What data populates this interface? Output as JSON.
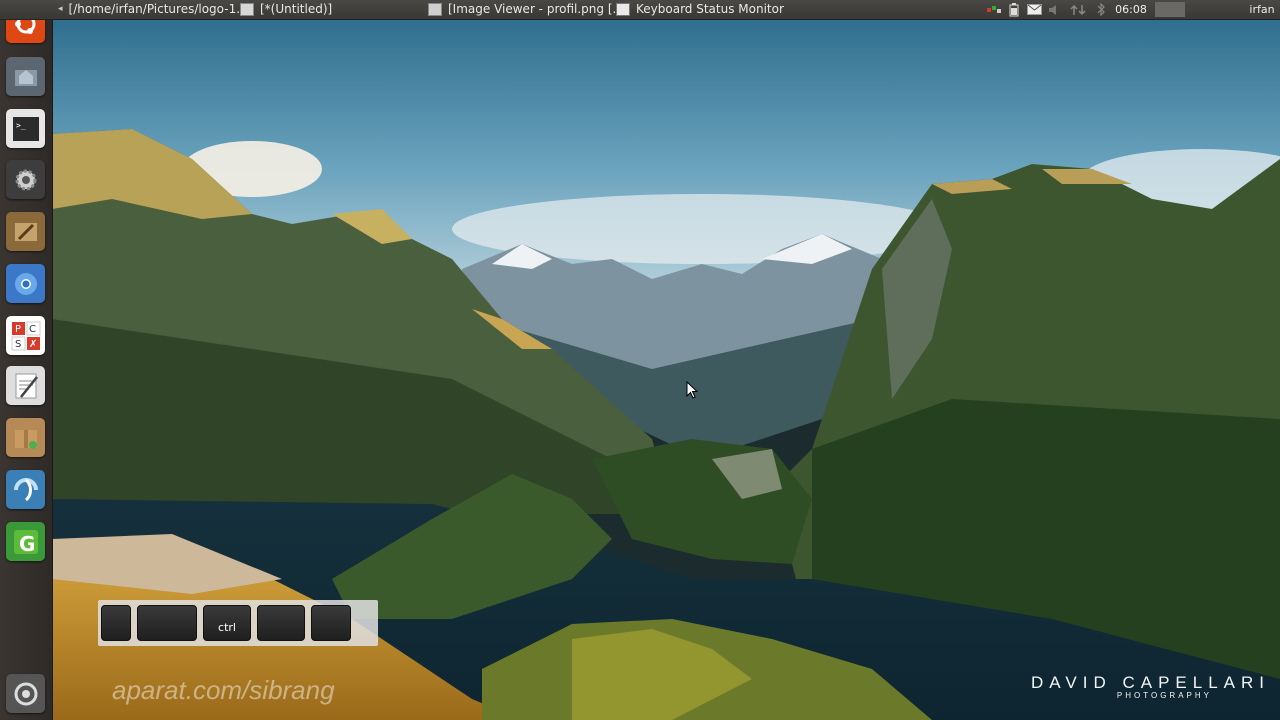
{
  "top_panel": {
    "tasks": [
      {
        "label": "[/home/irfan/Pictures/logo-1...",
        "icon": "terminal-icon"
      },
      {
        "label": "[*(Untitled)]",
        "icon": "text-editor-icon"
      },
      {
        "label": "[Image Viewer - profil.png [...",
        "icon": "image-viewer-icon"
      },
      {
        "label": "Keyboard Status Monitor",
        "icon": "keyboard-monitor-icon"
      }
    ],
    "tray_icons": [
      "network-icon",
      "battery-icon",
      "mail-icon",
      "volume-icon",
      "updates-icon",
      "bluetooth-icon"
    ],
    "clock": "06:08",
    "user": "irfan"
  },
  "launcher": {
    "items": [
      "ubuntu-dash-icon",
      "home-folder-icon",
      "terminal-icon",
      "system-settings-icon",
      "gimp-icon",
      "chromium-icon",
      "libreoffice-icon",
      "text-editor-icon",
      "archive-manager-icon",
      "blender-icon",
      "utility-g-icon",
      "workspace-switcher-icon"
    ]
  },
  "key_monitor": {
    "keys": [
      "",
      "",
      "ctrl",
      "",
      ""
    ]
  },
  "wallpaper": {
    "credit": "DAVID CAPELLARI",
    "credit_sub": "PHOTOGRAPHY",
    "watermark": "aparat.com/sibrang"
  }
}
